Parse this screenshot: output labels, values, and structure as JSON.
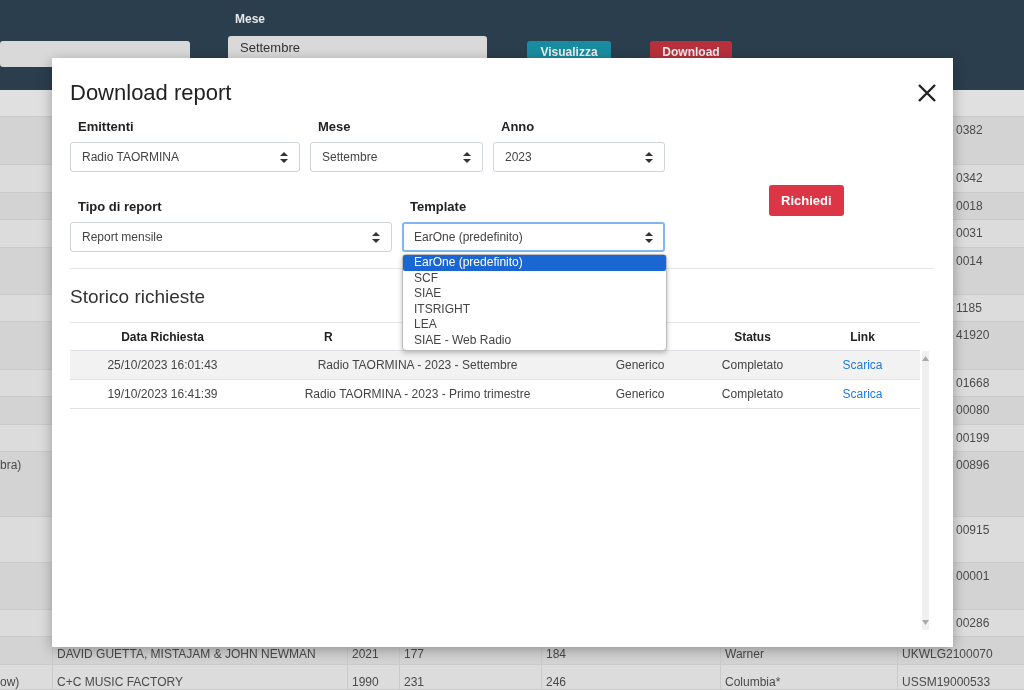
{
  "background": {
    "filter_label": "Mese",
    "month_select": "Settembre",
    "buttons": [
      {
        "label": "Visualizza",
        "kind": "info"
      },
      {
        "label": "Download",
        "kind": "danger"
      }
    ],
    "table_rows": [
      {
        "column_7": "0382"
      },
      {
        "column_7": "0342"
      },
      {
        "column_7": "0018"
      },
      {
        "column_7": "0031"
      },
      {
        "column_7": "0014"
      },
      {
        "column_7": "1185"
      },
      {
        "column_7": "41920"
      },
      {
        "column_7": "01668"
      },
      {
        "column_7": "00080"
      },
      {
        "column_7": "00199"
      },
      {
        "column_1": "bra)",
        "column_7": "00896"
      },
      {
        "column_7": "00915"
      },
      {
        "column_7": "00001"
      },
      {
        "column_7": "00286"
      },
      {
        "column_2": "DAVID GUETTA, MISTAJAM & JOHN NEWMAN",
        "column_3": "2021",
        "column_4": "177",
        "column_5": "184",
        "column_6": "Warner",
        "column_7": "UKWLG2100070"
      },
      {
        "column_1": "ow)",
        "column_2": "C+C MUSIC FACTORY",
        "column_3": "1990",
        "column_4": "231",
        "column_5": "246",
        "column_6": "Columbia*",
        "column_7": "USSM19000533"
      }
    ]
  },
  "modal": {
    "title": "Download report",
    "field_rows": [
      [
        {
          "label": "Emittenti",
          "value": "Radio TAORMINA",
          "focused": false
        },
        {
          "label": "Mese",
          "value": "Settembre",
          "focused": false
        },
        {
          "label": "Anno",
          "value": "2023",
          "focused": false
        }
      ],
      [
        {
          "label": "Tipo di report",
          "value": "Report mensile",
          "focused": false
        },
        {
          "label": "Template",
          "value": "EarOne (predefinito)",
          "focused": true
        }
      ]
    ],
    "request_button": "Richiedi",
    "history_title": "Storico richieste",
    "history_columns": {
      "date": "Data Richiesta",
      "report": "R",
      "status": "Status",
      "link": "Link"
    },
    "history_rows": [
      {
        "date": "25/10/2023 16:01:43",
        "report": "Radio TAORMINA - 2023 - Settembre",
        "type": "Generico",
        "status": "Completato",
        "link": "Scarica",
        "highlighted": true
      },
      {
        "date": "19/10/2023 16:41:39",
        "report": "Radio TAORMINA - 2023 - Primo trimestre",
        "type": "Generico",
        "status": "Completato",
        "link": "Scarica",
        "highlighted": false
      }
    ],
    "dropdown": {
      "options": [
        {
          "label": "EarOne (predefinito)",
          "selected": true
        },
        {
          "label": "SCF",
          "selected": false
        },
        {
          "label": "SIAE",
          "selected": false
        },
        {
          "label": "ITSRIGHT",
          "selected": false
        },
        {
          "label": "LEA",
          "selected": false
        },
        {
          "label": "SIAE - Web Radio",
          "selected": false
        }
      ]
    }
  }
}
